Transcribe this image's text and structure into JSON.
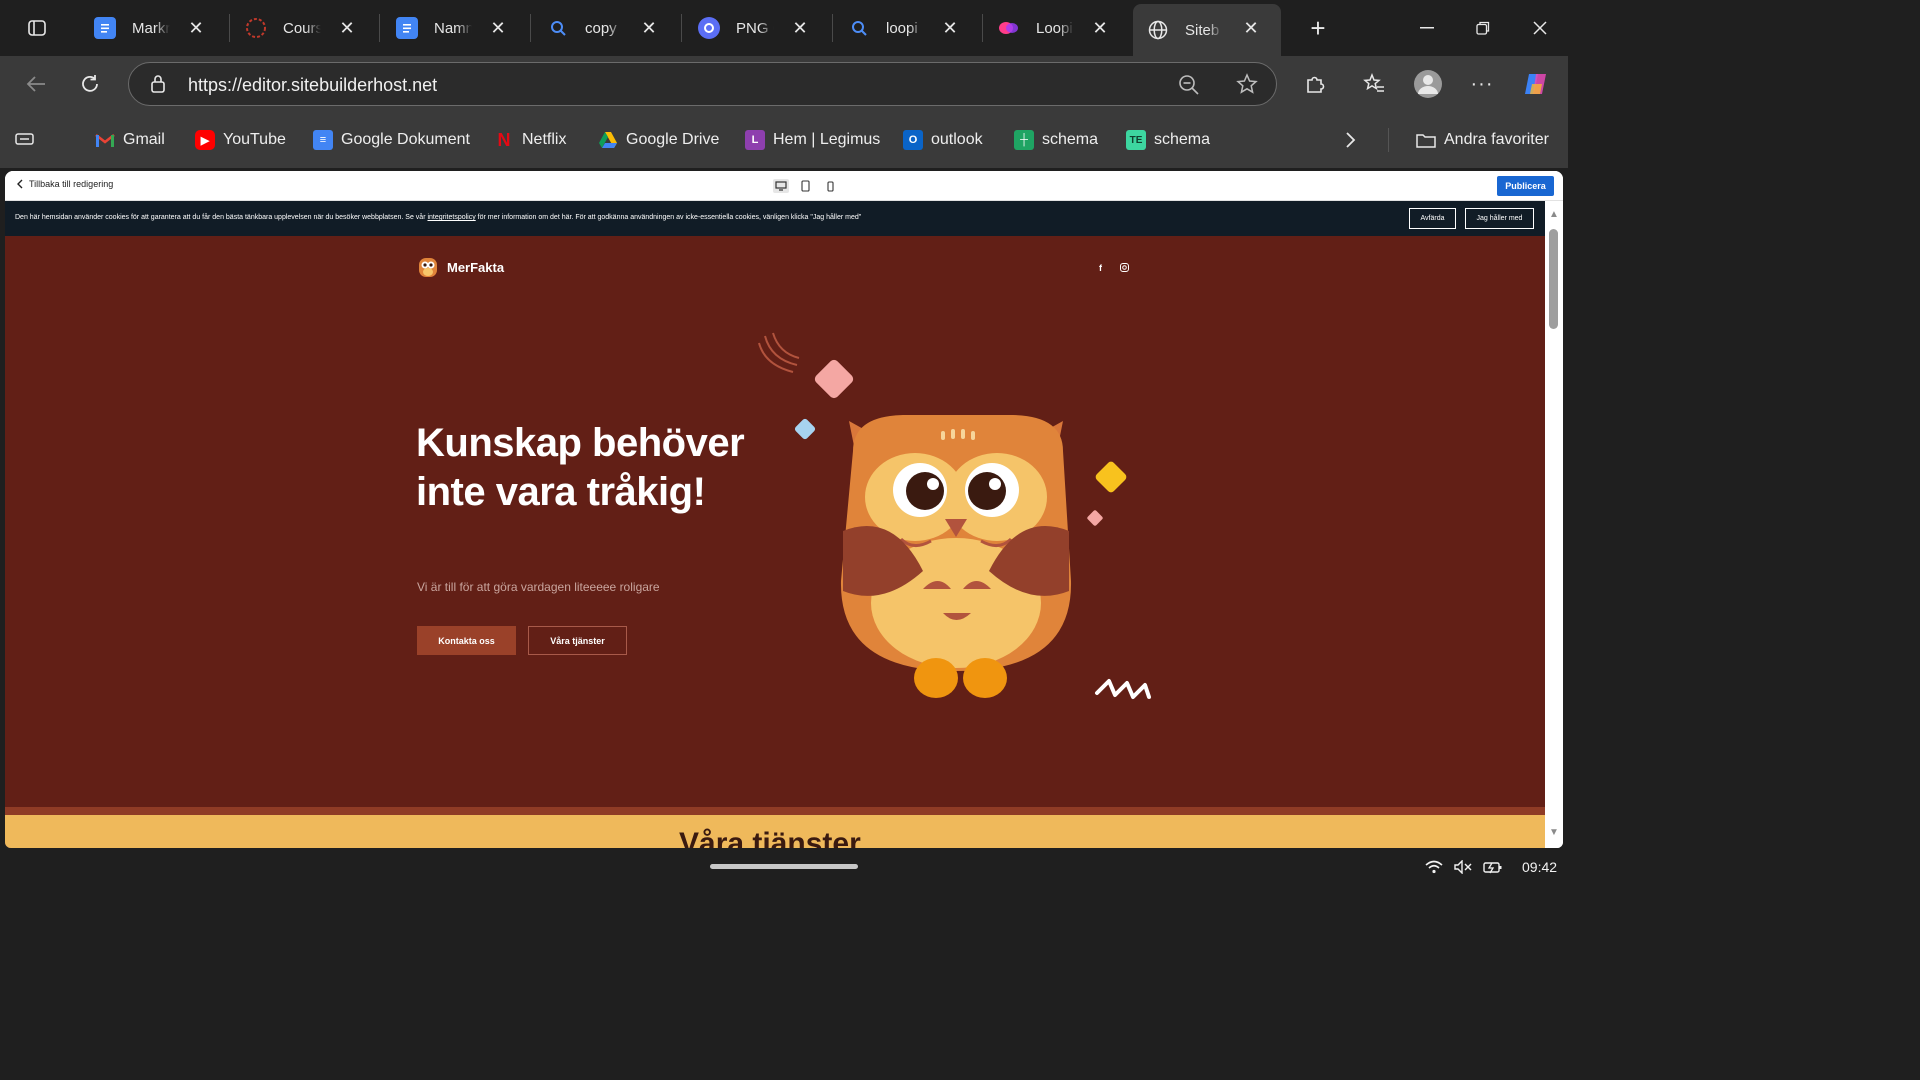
{
  "tabs": [
    {
      "title": "Markr",
      "icon": "google-docs-icon"
    },
    {
      "title": "Cours",
      "icon": "course-icon"
    },
    {
      "title": "Namn",
      "icon": "google-docs-icon"
    },
    {
      "title": "copy ",
      "icon": "search-icon"
    },
    {
      "title": "PNG C",
      "icon": "converter-icon"
    },
    {
      "title": "loopi",
      "icon": "search-icon"
    },
    {
      "title": "Loopi",
      "icon": "loopi-icon"
    },
    {
      "title": "Siteb",
      "icon": "globe-icon",
      "active": true
    }
  ],
  "address_bar": {
    "url": "https://editor.sitebuilderhost.net"
  },
  "bookmarks": {
    "items": [
      {
        "label": "Gmail",
        "icon": "gmail-icon"
      },
      {
        "label": "YouTube",
        "icon": "youtube-icon"
      },
      {
        "label": "Google Dokument",
        "icon": "google-docs-icon"
      },
      {
        "label": "Netflix",
        "icon": "netflix-icon"
      },
      {
        "label": "Google Drive",
        "icon": "google-drive-icon"
      },
      {
        "label": "Hem | Legimus",
        "icon": "legimus-icon"
      },
      {
        "label": "outlook",
        "icon": "outlook-icon"
      },
      {
        "label": "schema",
        "icon": "sheets-icon"
      },
      {
        "label": "schema",
        "icon": "te-icon"
      }
    ],
    "other_favorites": "Andra favoriter"
  },
  "editor": {
    "back_label": "Tillbaka till redigering",
    "publish_label": "Publicera",
    "device_modes": [
      "desktop",
      "tablet",
      "mobile"
    ]
  },
  "cookie_banner": {
    "text_before": "Den här hemsidan använder cookies för att garantera att du får den bästa tänkbara upplevelsen när du besöker webbplatsen. Se vår ",
    "link": "integritetspolicy",
    "text_after": " för mer information om det här. För att godkänna användningen av icke-essentiella cookies, vänligen klicka \"Jag håller med\"",
    "dismiss_label": "Avfärda",
    "accept_label": "Jag håller med"
  },
  "site": {
    "brand": "MerFakta",
    "hero": {
      "title": "Kunskap behöver inte vara tråkig!",
      "subtitle": "Vi är till för att göra vardagen liteeeee roligare",
      "primary_cta": "Kontakta oss",
      "secondary_cta": "Våra tjänster"
    },
    "services_heading": "Våra tjänster",
    "colors": {
      "hero_bg": "#621f16",
      "services_bg": "#efb95b",
      "primary_button": "#9a4129",
      "publish_button": "#1967d2"
    }
  },
  "system": {
    "time": "09:42"
  }
}
